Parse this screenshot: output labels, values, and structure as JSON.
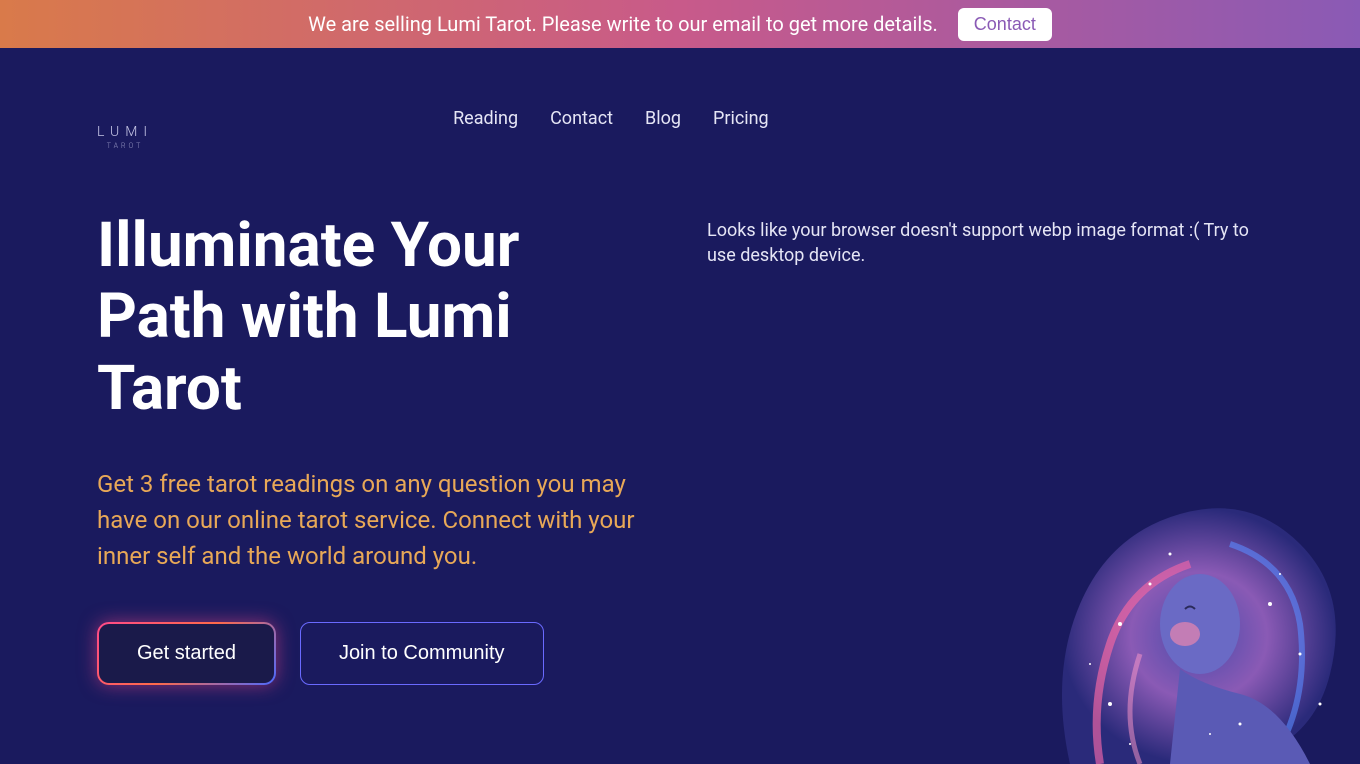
{
  "announcement": {
    "text": "We are selling Lumi Tarot. Please write to our email to get more details.",
    "button_label": "Contact"
  },
  "logo": {
    "main": "LUMI",
    "sub": "TAROT"
  },
  "nav": {
    "items": [
      {
        "label": "Reading"
      },
      {
        "label": "Contact"
      },
      {
        "label": "Blog"
      },
      {
        "label": "Pricing"
      }
    ]
  },
  "hero": {
    "title": "Illuminate Your Path with Lumi Tarot",
    "subtitle": "Get 3 free tarot readings on any question you may have on our online tarot service. Connect with your inner self and the world around you.",
    "primary_button": "Get started",
    "secondary_button": "Join to Community",
    "error_message": "Looks like your browser doesn't support webp image format :( Try to use desktop device."
  },
  "colors": {
    "background": "#1a1a5e",
    "accent_orange": "#e8a857",
    "gradient_start": "#d97a4a",
    "gradient_end": "#8a5ab5"
  }
}
